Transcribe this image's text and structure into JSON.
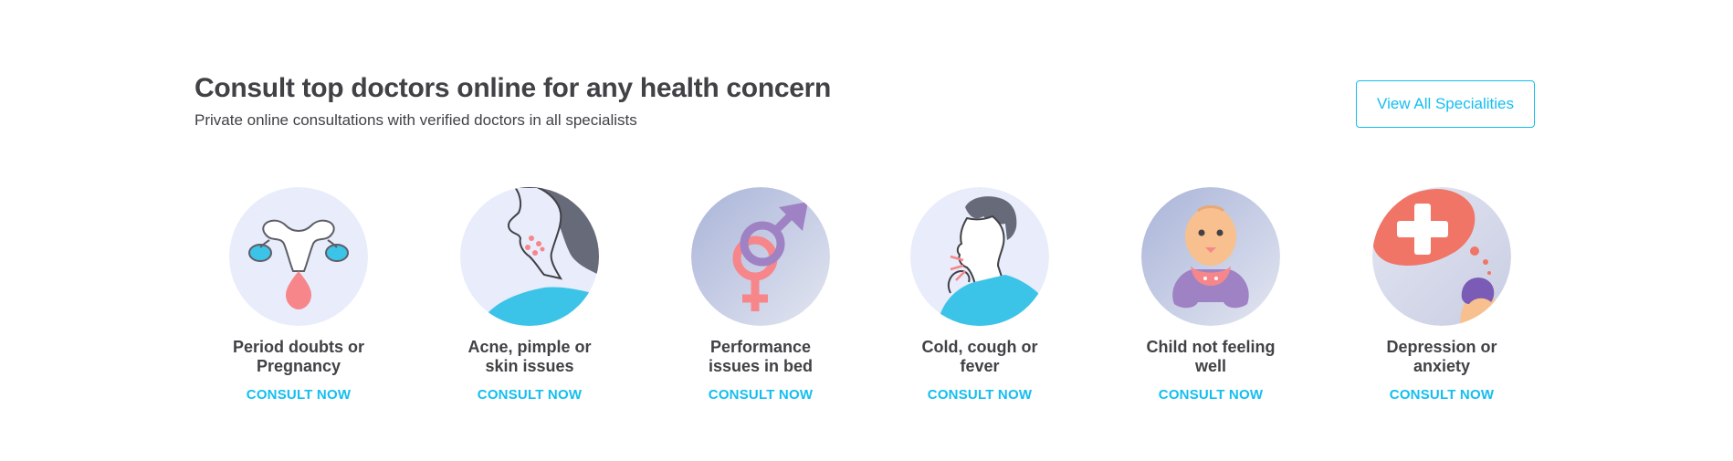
{
  "header": {
    "title": "Consult top doctors online for any health concern",
    "subtitle": "Private online consultations with verified doctors in all specialists"
  },
  "view_all_label": "View All Specialities",
  "specialities": [
    {
      "label_line1": "Period doubts or",
      "label_line2": "Pregnancy",
      "cta": "CONSULT NOW",
      "icon": "uterus-icon"
    },
    {
      "label_line1": "Acne, pimple or",
      "label_line2": "skin issues",
      "cta": "CONSULT NOW",
      "icon": "acne-face-icon"
    },
    {
      "label_line1": "Performance",
      "label_line2": "issues in bed",
      "cta": "CONSULT NOW",
      "icon": "gender-symbols-icon"
    },
    {
      "label_line1": "Cold, cough or",
      "label_line2": "fever",
      "cta": "CONSULT NOW",
      "icon": "coughing-person-icon"
    },
    {
      "label_line1": "Child not feeling",
      "label_line2": "well",
      "cta": "CONSULT NOW",
      "icon": "baby-icon"
    },
    {
      "label_line1": "Depression or",
      "label_line2": "anxiety",
      "cta": "CONSULT NOW",
      "icon": "mental-health-icon"
    }
  ],
  "colors": {
    "accent": "#14bef0",
    "text": "#414146",
    "circle_light": "#e8ecfb",
    "circle_grey": "#c9cde3"
  }
}
